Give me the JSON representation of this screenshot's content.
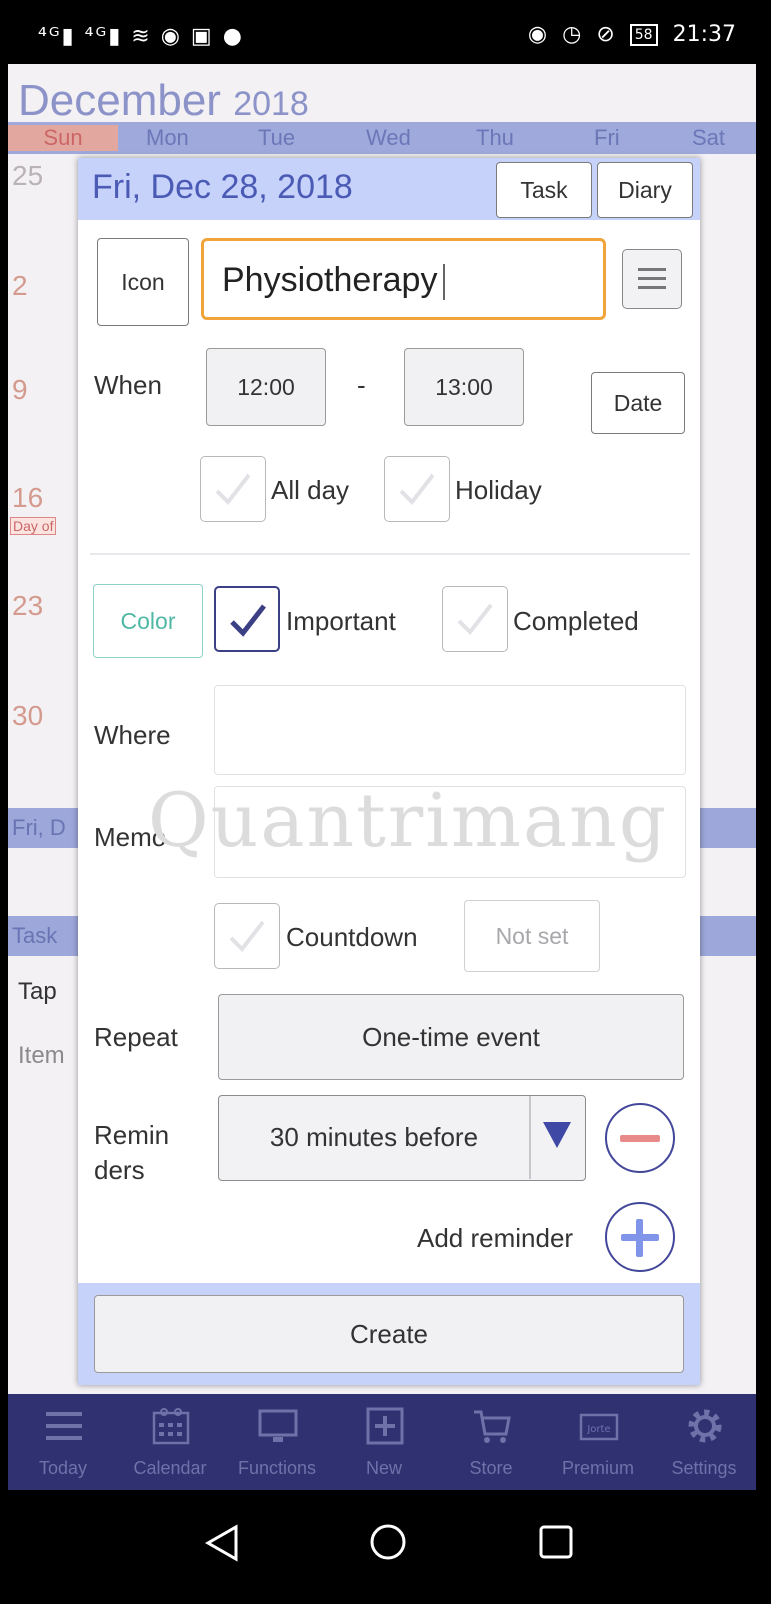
{
  "status_bar": {
    "left_icons": "⁴ᴳ▮ ⁴ᴳ▮ ≋ ◉ ▣ ●",
    "battery": "58",
    "time": "21:37"
  },
  "calendar_bg": {
    "month": "December",
    "year": "2018",
    "weekdays": [
      "Sun",
      "Mon",
      "Tue",
      "Wed",
      "Thu",
      "Fri",
      "Sat"
    ],
    "day_numbers": [
      "25",
      "2",
      "9",
      "16",
      "23",
      "30"
    ],
    "day_off": "Day of",
    "date_band": "Fri, D",
    "task_band": "Task",
    "tap_text": "Tap",
    "item_text": "Item"
  },
  "dialog": {
    "header_date": "Fri, Dec 28, 2018",
    "task_label": "Task",
    "diary_label": "Diary",
    "icon_label": "Icon",
    "title_value": "Physiotherapy",
    "when_label": "When",
    "start_time": "12:00",
    "dash": "-",
    "end_time": "13:00",
    "date_label": "Date",
    "all_day_label": "All day",
    "all_day_checked": false,
    "holiday_label": "Holiday",
    "holiday_checked": false,
    "color_label": "Color",
    "color_accent": "#4fb8a4",
    "important_label": "Important",
    "important_checked": true,
    "completed_label": "Completed",
    "completed_checked": false,
    "where_label": "Where",
    "where_value": "",
    "memo_label": "Memo",
    "memo_value": "",
    "countdown_label": "Countdown",
    "countdown_checked": false,
    "not_set_label": "Not set",
    "repeat_label": "Repeat",
    "repeat_value": "One-time event",
    "reminders_label_1": "Remin",
    "reminders_label_2": "ders",
    "reminder_value": "30 minutes before",
    "add_reminder_label": "Add reminder",
    "create_label": "Create",
    "watermark": "Quantrimang"
  },
  "app_nav": [
    {
      "label": "Today",
      "icon": "menu-lines-icon"
    },
    {
      "label": "Calendar",
      "icon": "calendar-icon"
    },
    {
      "label": "Functions",
      "icon": "monitor-icon"
    },
    {
      "label": "New",
      "icon": "plus-box-icon"
    },
    {
      "label": "Store",
      "icon": "cart-icon"
    },
    {
      "label": "Premium",
      "icon": "jorte-icon"
    },
    {
      "label": "Settings",
      "icon": "gear-icon"
    }
  ],
  "colors": {
    "header_bg": "#c7d2fb",
    "header_text": "#4a5ab5",
    "input_focus": "#f0a43a",
    "nav_bg": "#2f3171",
    "check_color": "#3b3f84"
  }
}
